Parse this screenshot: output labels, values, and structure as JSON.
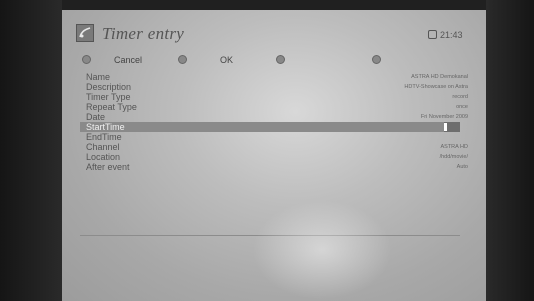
{
  "header": {
    "title": "Timer entry",
    "clock": "21:43"
  },
  "buttons": {
    "cancel": "Cancel",
    "ok": "OK"
  },
  "fields": [
    {
      "label": "Name",
      "value": "ASTRA HD Demokanal"
    },
    {
      "label": "Description",
      "value": "HDTV-Showcase on Astra"
    },
    {
      "label": "Timer Type",
      "value": "record"
    },
    {
      "label": "Repeat Type",
      "value": "once"
    },
    {
      "label": "Date",
      "value": "Fri November 2009"
    },
    {
      "label": "StartTime",
      "value": ""
    },
    {
      "label": "EndTime",
      "value": ""
    },
    {
      "label": "Channel",
      "value": "ASTRA HD"
    },
    {
      "label": "Location",
      "value": "/hdd/movie/"
    },
    {
      "label": "After event",
      "value": "Auto"
    }
  ]
}
